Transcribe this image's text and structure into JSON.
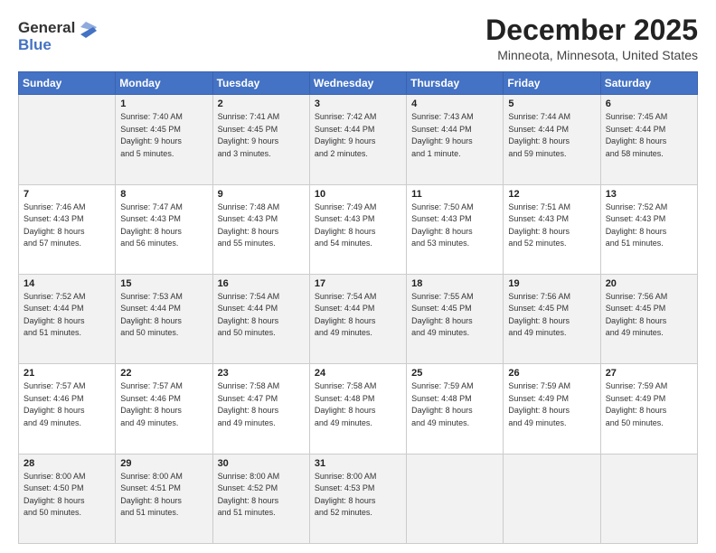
{
  "logo": {
    "general": "General",
    "blue": "Blue"
  },
  "header": {
    "title": "December 2025",
    "subtitle": "Minneota, Minnesota, United States"
  },
  "days_of_week": [
    "Sunday",
    "Monday",
    "Tuesday",
    "Wednesday",
    "Thursday",
    "Friday",
    "Saturday"
  ],
  "weeks": [
    [
      {
        "day": "",
        "sunrise": "",
        "sunset": "",
        "daylight": ""
      },
      {
        "day": "1",
        "sunrise": "Sunrise: 7:40 AM",
        "sunset": "Sunset: 4:45 PM",
        "daylight": "Daylight: 9 hours and 5 minutes."
      },
      {
        "day": "2",
        "sunrise": "Sunrise: 7:41 AM",
        "sunset": "Sunset: 4:45 PM",
        "daylight": "Daylight: 9 hours and 3 minutes."
      },
      {
        "day": "3",
        "sunrise": "Sunrise: 7:42 AM",
        "sunset": "Sunset: 4:44 PM",
        "daylight": "Daylight: 9 hours and 2 minutes."
      },
      {
        "day": "4",
        "sunrise": "Sunrise: 7:43 AM",
        "sunset": "Sunset: 4:44 PM",
        "daylight": "Daylight: 9 hours and 1 minute."
      },
      {
        "day": "5",
        "sunrise": "Sunrise: 7:44 AM",
        "sunset": "Sunset: 4:44 PM",
        "daylight": "Daylight: 8 hours and 59 minutes."
      },
      {
        "day": "6",
        "sunrise": "Sunrise: 7:45 AM",
        "sunset": "Sunset: 4:44 PM",
        "daylight": "Daylight: 8 hours and 58 minutes."
      }
    ],
    [
      {
        "day": "7",
        "sunrise": "Sunrise: 7:46 AM",
        "sunset": "Sunset: 4:43 PM",
        "daylight": "Daylight: 8 hours and 57 minutes."
      },
      {
        "day": "8",
        "sunrise": "Sunrise: 7:47 AM",
        "sunset": "Sunset: 4:43 PM",
        "daylight": "Daylight: 8 hours and 56 minutes."
      },
      {
        "day": "9",
        "sunrise": "Sunrise: 7:48 AM",
        "sunset": "Sunset: 4:43 PM",
        "daylight": "Daylight: 8 hours and 55 minutes."
      },
      {
        "day": "10",
        "sunrise": "Sunrise: 7:49 AM",
        "sunset": "Sunset: 4:43 PM",
        "daylight": "Daylight: 8 hours and 54 minutes."
      },
      {
        "day": "11",
        "sunrise": "Sunrise: 7:50 AM",
        "sunset": "Sunset: 4:43 PM",
        "daylight": "Daylight: 8 hours and 53 minutes."
      },
      {
        "day": "12",
        "sunrise": "Sunrise: 7:51 AM",
        "sunset": "Sunset: 4:43 PM",
        "daylight": "Daylight: 8 hours and 52 minutes."
      },
      {
        "day": "13",
        "sunrise": "Sunrise: 7:52 AM",
        "sunset": "Sunset: 4:43 PM",
        "daylight": "Daylight: 8 hours and 51 minutes."
      }
    ],
    [
      {
        "day": "14",
        "sunrise": "Sunrise: 7:52 AM",
        "sunset": "Sunset: 4:44 PM",
        "daylight": "Daylight: 8 hours and 51 minutes."
      },
      {
        "day": "15",
        "sunrise": "Sunrise: 7:53 AM",
        "sunset": "Sunset: 4:44 PM",
        "daylight": "Daylight: 8 hours and 50 minutes."
      },
      {
        "day": "16",
        "sunrise": "Sunrise: 7:54 AM",
        "sunset": "Sunset: 4:44 PM",
        "daylight": "Daylight: 8 hours and 50 minutes."
      },
      {
        "day": "17",
        "sunrise": "Sunrise: 7:54 AM",
        "sunset": "Sunset: 4:44 PM",
        "daylight": "Daylight: 8 hours and 49 minutes."
      },
      {
        "day": "18",
        "sunrise": "Sunrise: 7:55 AM",
        "sunset": "Sunset: 4:45 PM",
        "daylight": "Daylight: 8 hours and 49 minutes."
      },
      {
        "day": "19",
        "sunrise": "Sunrise: 7:56 AM",
        "sunset": "Sunset: 4:45 PM",
        "daylight": "Daylight: 8 hours and 49 minutes."
      },
      {
        "day": "20",
        "sunrise": "Sunrise: 7:56 AM",
        "sunset": "Sunset: 4:45 PM",
        "daylight": "Daylight: 8 hours and 49 minutes."
      }
    ],
    [
      {
        "day": "21",
        "sunrise": "Sunrise: 7:57 AM",
        "sunset": "Sunset: 4:46 PM",
        "daylight": "Daylight: 8 hours and 49 minutes."
      },
      {
        "day": "22",
        "sunrise": "Sunrise: 7:57 AM",
        "sunset": "Sunset: 4:46 PM",
        "daylight": "Daylight: 8 hours and 49 minutes."
      },
      {
        "day": "23",
        "sunrise": "Sunrise: 7:58 AM",
        "sunset": "Sunset: 4:47 PM",
        "daylight": "Daylight: 8 hours and 49 minutes."
      },
      {
        "day": "24",
        "sunrise": "Sunrise: 7:58 AM",
        "sunset": "Sunset: 4:48 PM",
        "daylight": "Daylight: 8 hours and 49 minutes."
      },
      {
        "day": "25",
        "sunrise": "Sunrise: 7:59 AM",
        "sunset": "Sunset: 4:48 PM",
        "daylight": "Daylight: 8 hours and 49 minutes."
      },
      {
        "day": "26",
        "sunrise": "Sunrise: 7:59 AM",
        "sunset": "Sunset: 4:49 PM",
        "daylight": "Daylight: 8 hours and 49 minutes."
      },
      {
        "day": "27",
        "sunrise": "Sunrise: 7:59 AM",
        "sunset": "Sunset: 4:49 PM",
        "daylight": "Daylight: 8 hours and 50 minutes."
      }
    ],
    [
      {
        "day": "28",
        "sunrise": "Sunrise: 8:00 AM",
        "sunset": "Sunset: 4:50 PM",
        "daylight": "Daylight: 8 hours and 50 minutes."
      },
      {
        "day": "29",
        "sunrise": "Sunrise: 8:00 AM",
        "sunset": "Sunset: 4:51 PM",
        "daylight": "Daylight: 8 hours and 51 minutes."
      },
      {
        "day": "30",
        "sunrise": "Sunrise: 8:00 AM",
        "sunset": "Sunset: 4:52 PM",
        "daylight": "Daylight: 8 hours and 51 minutes."
      },
      {
        "day": "31",
        "sunrise": "Sunrise: 8:00 AM",
        "sunset": "Sunset: 4:53 PM",
        "daylight": "Daylight: 8 hours and 52 minutes."
      },
      {
        "day": "",
        "sunrise": "",
        "sunset": "",
        "daylight": ""
      },
      {
        "day": "",
        "sunrise": "",
        "sunset": "",
        "daylight": ""
      },
      {
        "day": "",
        "sunrise": "",
        "sunset": "",
        "daylight": ""
      }
    ]
  ]
}
